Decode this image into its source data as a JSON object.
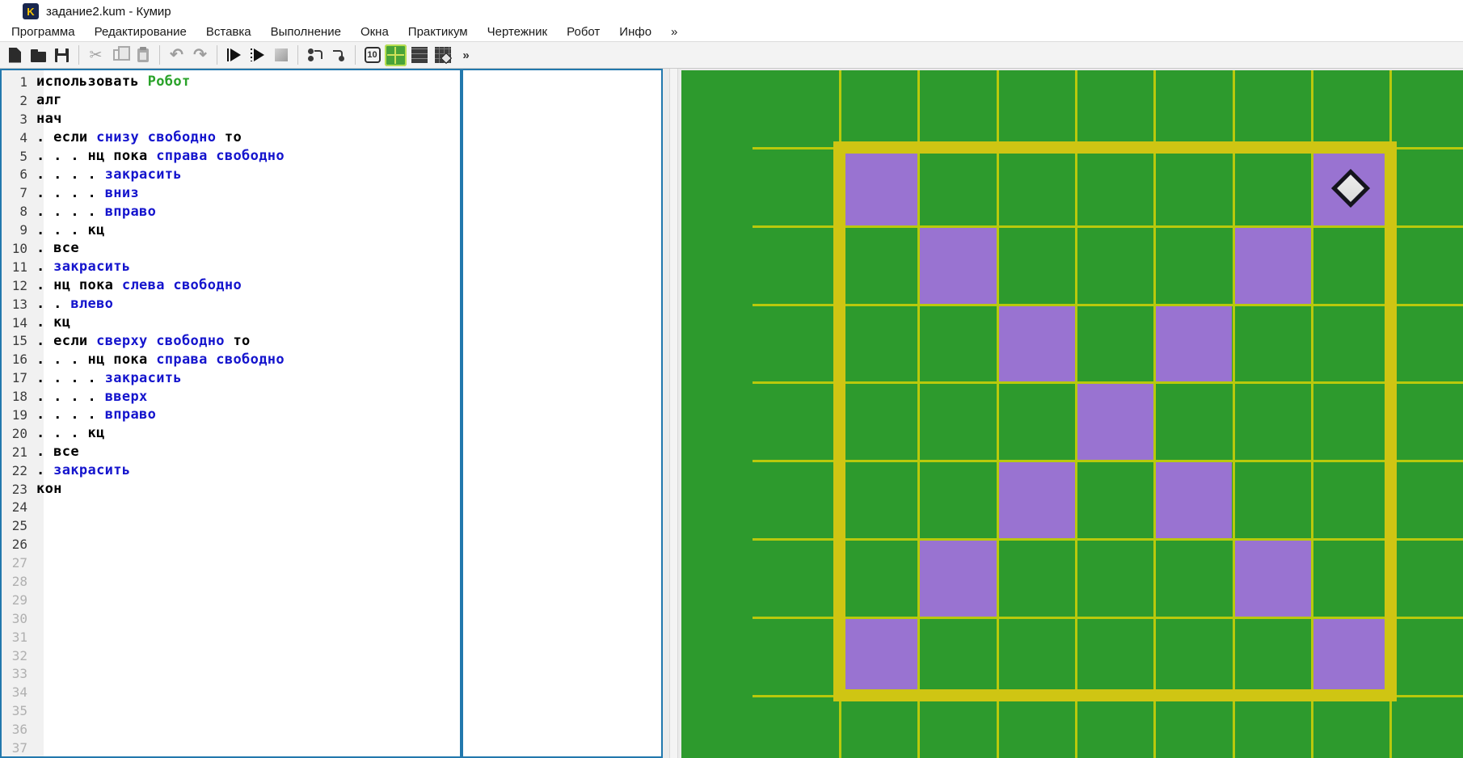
{
  "window": {
    "title": "задание2.kum - Кумир",
    "app_icon_letter": "K"
  },
  "menu": {
    "items": [
      "Программа",
      "Редактирование",
      "Вставка",
      "Выполнение",
      "Окна",
      "Практикум",
      "Чертежник",
      "Робот",
      "Инфо",
      "»"
    ]
  },
  "toolbar": {
    "buttons": [
      {
        "name": "new-file-button",
        "icon": "new-file-icon",
        "cls": "i-new",
        "enabled": true
      },
      {
        "name": "open-file-button",
        "icon": "open-folder-icon",
        "cls": "i-open",
        "enabled": true
      },
      {
        "name": "save-button",
        "icon": "save-floppy-icon",
        "cls": "i-save",
        "enabled": true
      },
      {
        "sep": true
      },
      {
        "name": "cut-button",
        "icon": "cut-scissors-icon",
        "cls": "i-cut",
        "glyph": "✂",
        "enabled": false
      },
      {
        "name": "copy-button",
        "icon": "copy-icon",
        "cls": "i-copy",
        "enabled": false
      },
      {
        "name": "paste-button",
        "icon": "paste-clipboard-icon",
        "cls": "i-paste",
        "enabled": false
      },
      {
        "sep": true
      },
      {
        "name": "undo-button",
        "icon": "undo-arrow-icon",
        "cls": "i-undo",
        "glyph": "↶",
        "enabled": false
      },
      {
        "name": "redo-button",
        "icon": "redo-arrow-icon",
        "cls": "i-redo",
        "glyph": "↷",
        "enabled": false
      },
      {
        "sep": true
      },
      {
        "name": "run-button",
        "icon": "run-play-icon",
        "cls": "i-run",
        "enabled": true
      },
      {
        "name": "run-step-button",
        "icon": "run-play-dotted-icon",
        "cls": "i-run2",
        "enabled": true
      },
      {
        "name": "stop-button",
        "icon": "stop-square-icon",
        "cls": "i-stop",
        "enabled": false
      },
      {
        "sep": true
      },
      {
        "name": "step-over-button",
        "icon": "step-over-icon",
        "cls": "i-step",
        "enabled": true
      },
      {
        "name": "step-out-button",
        "icon": "step-out-icon",
        "cls": "i-step2",
        "enabled": true
      },
      {
        "sep": true
      },
      {
        "name": "show-values-button",
        "icon": "values-10-icon",
        "cls": "i-ten",
        "glyph": "10",
        "enabled": true
      },
      {
        "name": "robot-window-button",
        "icon": "robot-crosshair-icon",
        "cls": "i-cross",
        "enabled": true,
        "active": true
      },
      {
        "name": "grid-window-button",
        "icon": "grid-icon",
        "cls": "i-grid",
        "enabled": true
      },
      {
        "name": "robot-field-button",
        "icon": "robot-field-icon",
        "cls": "i-field",
        "enabled": true
      },
      {
        "name": "toolbar-overflow-button",
        "icon": "chevron-more-icon",
        "cls": "i-more",
        "glyph": "»",
        "enabled": true
      }
    ]
  },
  "editor": {
    "visible_line_numbers_from": 1,
    "visible_line_numbers_to": 37,
    "dim_numbers_from": 27,
    "lines": [
      {
        "n": 1,
        "t": [
          [
            "использовать ",
            "k"
          ],
          [
            "Робот",
            "g"
          ]
        ]
      },
      {
        "n": 2,
        "t": [
          [
            "алг",
            "k"
          ]
        ]
      },
      {
        "n": 3,
        "t": [
          [
            "нач",
            "k"
          ]
        ]
      },
      {
        "n": 4,
        "t": [
          [
            ". если ",
            "k"
          ],
          [
            "снизу свободно",
            "b"
          ],
          [
            " то",
            "k"
          ]
        ]
      },
      {
        "n": 5,
        "t": [
          [
            ". . . нц пока ",
            "k"
          ],
          [
            "справа свободно",
            "b"
          ]
        ]
      },
      {
        "n": 6,
        "t": [
          [
            ". . . . ",
            "k"
          ],
          [
            "закрасить",
            "b"
          ]
        ]
      },
      {
        "n": 7,
        "t": [
          [
            ". . . . ",
            "k"
          ],
          [
            "вниз",
            "b"
          ]
        ]
      },
      {
        "n": 8,
        "t": [
          [
            ". . . . ",
            "k"
          ],
          [
            "вправо",
            "b"
          ]
        ]
      },
      {
        "n": 9,
        "t": [
          [
            ". . . кц",
            "k"
          ]
        ]
      },
      {
        "n": 10,
        "t": [
          [
            ". все",
            "k"
          ]
        ]
      },
      {
        "n": 11,
        "t": [
          [
            ". ",
            "k"
          ],
          [
            "закрасить",
            "b"
          ]
        ]
      },
      {
        "n": 12,
        "t": [
          [
            ". нц пока ",
            "k"
          ],
          [
            "слева свободно",
            "b"
          ]
        ]
      },
      {
        "n": 13,
        "t": [
          [
            ". . ",
            "k"
          ],
          [
            "влево",
            "b"
          ]
        ]
      },
      {
        "n": 14,
        "t": [
          [
            ". кц",
            "k"
          ]
        ]
      },
      {
        "n": 15,
        "t": [
          [
            ". если ",
            "k"
          ],
          [
            "сверху свободно",
            "b"
          ],
          [
            " то",
            "k"
          ]
        ]
      },
      {
        "n": 16,
        "t": [
          [
            ". . . нц пока ",
            "k"
          ],
          [
            "справа свободно",
            "b"
          ]
        ]
      },
      {
        "n": 17,
        "t": [
          [
            ". . . . ",
            "k"
          ],
          [
            "закрасить",
            "b"
          ]
        ]
      },
      {
        "n": 18,
        "t": [
          [
            ". . . . ",
            "k"
          ],
          [
            "вверх",
            "b"
          ]
        ]
      },
      {
        "n": 19,
        "t": [
          [
            ". . . . ",
            "k"
          ],
          [
            "вправо",
            "b"
          ]
        ]
      },
      {
        "n": 20,
        "t": [
          [
            ". . . кц",
            "k"
          ]
        ]
      },
      {
        "n": 21,
        "t": [
          [
            ". все",
            "k"
          ]
        ]
      },
      {
        "n": 22,
        "t": [
          [
            ". закрасить",
            "mixdot"
          ]
        ]
      },
      {
        "n": 23,
        "t": [
          [
            "кон",
            "k"
          ]
        ]
      }
    ]
  },
  "robot_field": {
    "grid": {
      "cols": 7,
      "rows": 7
    },
    "painted_cells": [
      [
        1,
        1
      ],
      [
        1,
        7
      ],
      [
        2,
        2
      ],
      [
        2,
        6
      ],
      [
        3,
        3
      ],
      [
        3,
        5
      ],
      [
        4,
        4
      ],
      [
        5,
        3
      ],
      [
        5,
        5
      ],
      [
        6,
        2
      ],
      [
        6,
        6
      ],
      [
        7,
        1
      ],
      [
        7,
        7
      ]
    ],
    "robot_cell": [
      1,
      7
    ],
    "colors": {
      "background": "#2d9a2d",
      "grid_line": "#b9c90c",
      "wall": "#cfc513",
      "painted": "#9973d1",
      "robot_fill": "#dbdbdb",
      "robot_border": "#14141c"
    }
  }
}
